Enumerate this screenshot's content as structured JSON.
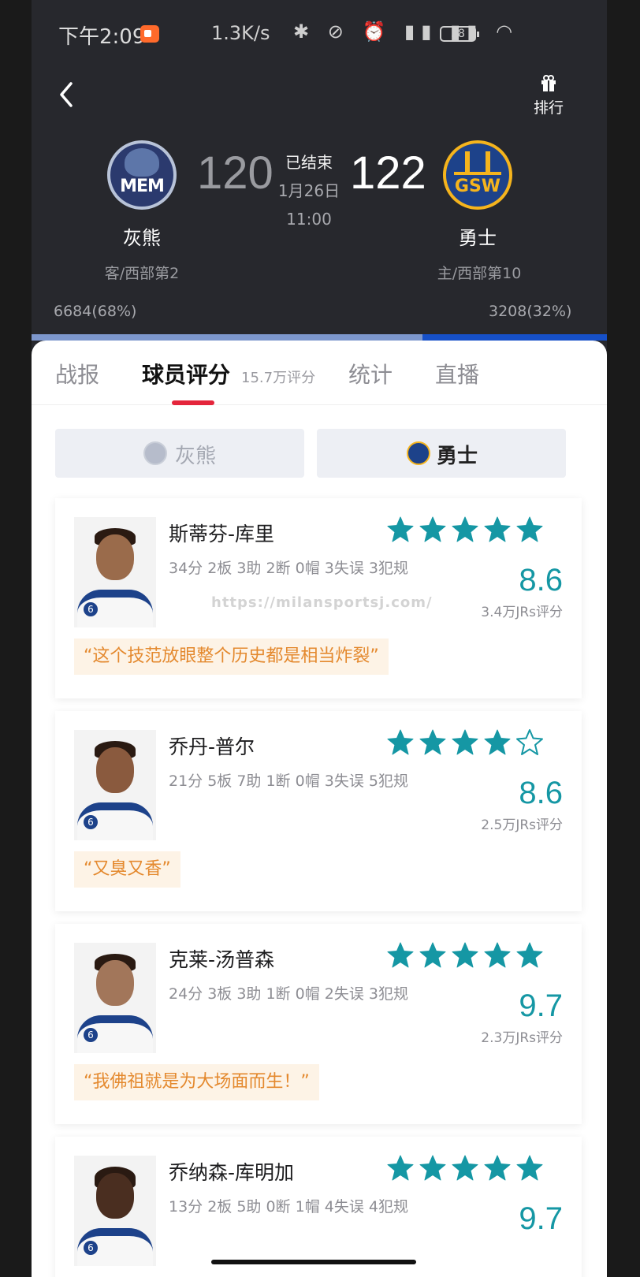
{
  "status_bar": {
    "time": "下午2:09",
    "net_speed": "1.3K/s",
    "icons": "✱ ⊘ ⏰ ▮▮ ▮▮ ◠",
    "battery": "58"
  },
  "header": {
    "rank_label": "排行",
    "match_status": "已结束",
    "match_date": "1月26日",
    "match_time": "11:00",
    "away": {
      "logo_text": "MEM",
      "score": "120",
      "name": "灰熊",
      "rank": "客/西部第2",
      "votes": "6684(68%)",
      "vote_share": 0.68
    },
    "home": {
      "logo_text": "GSW",
      "score": "122",
      "name": "勇士",
      "rank": "主/西部第10",
      "votes": "3208(32%)"
    }
  },
  "tabs": {
    "report": "战报",
    "rating": "球员评分",
    "rating_count": "15.7万评分",
    "stats": "统计",
    "live": "直播"
  },
  "team_switch": {
    "away": "灰熊",
    "home": "勇士"
  },
  "watermark": "https://milansportsj.com/",
  "players": [
    {
      "name": "斯蒂芬-库里",
      "stats": "34分 2板 3助 2断 0帽 3失误 3犯规",
      "rating": "8.6",
      "rating_count": "3.4万JRs评分",
      "stars_filled": 5,
      "quote": "“这个技范放眼整个历史都是相当炸裂”"
    },
    {
      "name": "乔丹-普尔",
      "stats": "21分 5板 7助 1断 0帽 3失误 5犯规",
      "rating": "8.6",
      "rating_count": "2.5万JRs评分",
      "stars_filled": 4,
      "quote": "“又臭又香”"
    },
    {
      "name": "克莱-汤普森",
      "stats": "24分 3板 3助 1断 0帽 2失误 3犯规",
      "rating": "9.7",
      "rating_count": "2.3万JRs评分",
      "stars_filled": 5,
      "quote": "“我佛祖就是为大场面而生！”"
    },
    {
      "name": "乔纳森-库明加",
      "stats": "13分 2板 5助 0断 1帽 4失误 4犯规",
      "rating": "9.7",
      "stars_filled": 5
    }
  ],
  "colors": {
    "accent": "#1597a4",
    "tab_underline": "#e4253b",
    "quote_text": "#e4892e",
    "header_bg": "#27282d"
  }
}
